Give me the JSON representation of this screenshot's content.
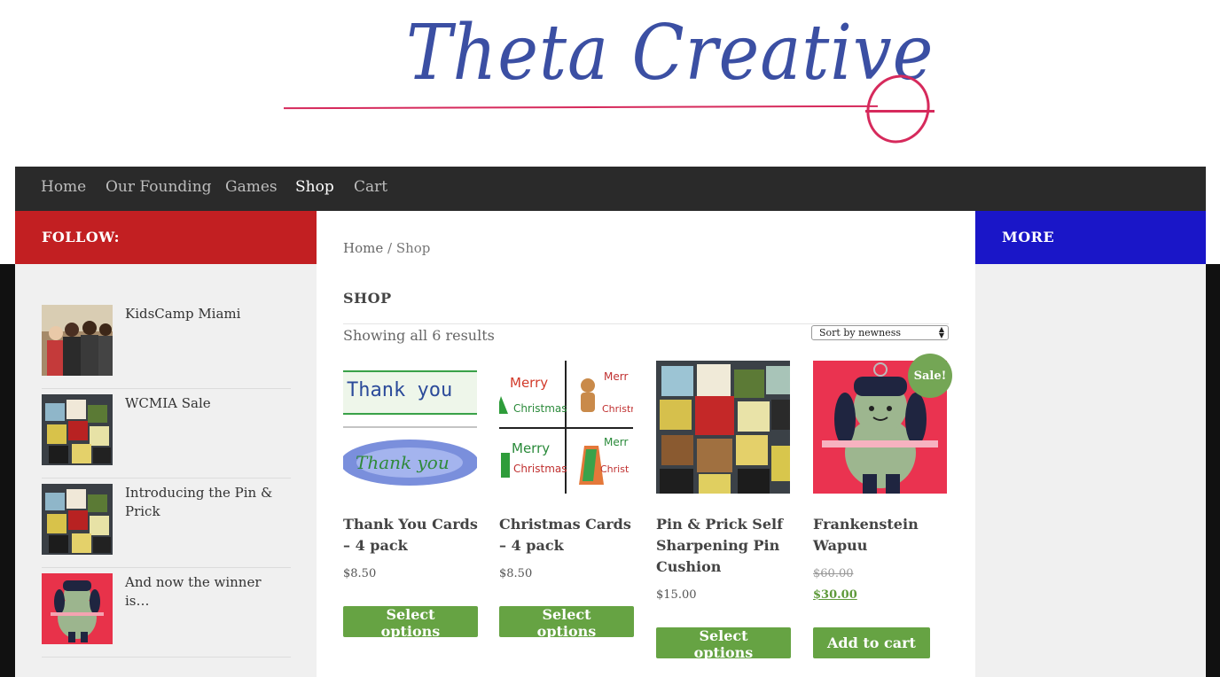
{
  "site": {
    "logo_text": "Theta Creative"
  },
  "nav": {
    "items": [
      {
        "label": "Home"
      },
      {
        "label": "Our Founding"
      },
      {
        "label": "Games"
      },
      {
        "label": "Shop"
      },
      {
        "label": "Cart"
      }
    ],
    "active": "Shop"
  },
  "sidebar_left": {
    "heading": "FOLLOW:",
    "posts": [
      {
        "title": "KidsCamp Miami"
      },
      {
        "title": "WCMIA Sale"
      },
      {
        "title": "Introducing the Pin & Prick"
      },
      {
        "title": "And now the winner is…"
      }
    ]
  },
  "main": {
    "breadcrumb": {
      "home": "Home",
      "sep": "/",
      "current": "Shop"
    },
    "title": "SHOP",
    "result_count": "Showing all 6 results",
    "sort": {
      "selected": "Sort by newness"
    },
    "products": [
      {
        "name": "Thank You Cards – 4 pack",
        "price": "$8.50",
        "button": "Select options"
      },
      {
        "name": "Christmas Cards – 4 pack",
        "price": "$8.50",
        "button": "Select options"
      },
      {
        "name": "Pin & Prick Self Sharpening Pin Cushion",
        "price": "$15.00",
        "button": "Select options"
      },
      {
        "name": "Frankenstein Wapuu",
        "old_price": "$60.00",
        "price": "$30.00",
        "button": "Add to cart",
        "badge": "Sale!"
      }
    ]
  },
  "sidebar_right": {
    "heading": "MORE"
  },
  "colors": {
    "follow_bar": "#c21f22",
    "more_bar": "#1a16c8",
    "nav_bg": "#2a2a2a",
    "button_green": "#66a343"
  }
}
